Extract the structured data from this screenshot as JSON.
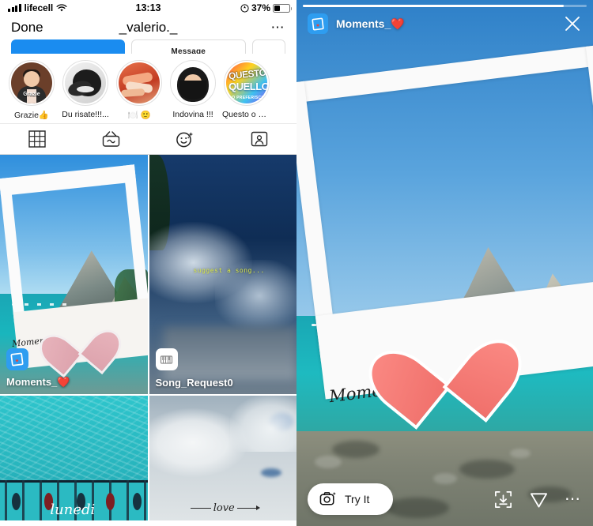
{
  "left_panel": {
    "status_bar": {
      "carrier": "lifecell",
      "time": "13:13",
      "battery_percent": "37%",
      "signal_icon": "signal-bars-icon",
      "wifi_icon": "wifi-icon",
      "location_icon": "location-services-icon",
      "battery_icon": "battery-icon"
    },
    "nav": {
      "done_label": "Done",
      "title": "_valerio._",
      "more_icon": "more-dots-icon"
    },
    "action_buttons": [
      {
        "label": "",
        "style": "primary"
      },
      {
        "label": "Message",
        "style": "ghost"
      },
      {
        "label": "",
        "style": "small"
      }
    ],
    "highlights": [
      {
        "label": "Grazie👍",
        "avatar": "grazie-avatar",
        "inner_text": "Grazie"
      },
      {
        "label": "Du risate!!!...",
        "avatar": "du-risate-avatar"
      },
      {
        "label": "🍽️ 🙂",
        "avatar": "food-avatar"
      },
      {
        "label": "Indovina !!!",
        "avatar": "indovina-avatar"
      },
      {
        "label": "Questo o Q...",
        "avatar": "questo-avatar",
        "art_lines": [
          "QUESTO",
          "QUELLO",
          "O PREFERISCI"
        ]
      }
    ],
    "tabs": [
      {
        "name": "grid-tab",
        "icon": "grid-icon",
        "selected": false
      },
      {
        "name": "igtv-tab",
        "icon": "igtv-icon",
        "selected": false
      },
      {
        "name": "effects-tab",
        "icon": "effects-smiley-icon",
        "selected": true
      },
      {
        "name": "tagged-tab",
        "icon": "tagged-person-icon",
        "selected": false
      }
    ],
    "grid_items": [
      {
        "label": "Moments_❤️",
        "badge_icon": "polaroid-effect-icon",
        "badge_style": "blue",
        "scene": "beach-polaroid",
        "overlay_script": "Moments_"
      },
      {
        "label": "Song_Request0",
        "badge_icon": "piano-keys-icon",
        "badge_style": "white",
        "scene": "dark-clouds",
        "overlay_text": "suggest a song..."
      },
      {
        "label": "",
        "scene": "turquoise-pool",
        "overlay_script": "lunedi"
      },
      {
        "label": "",
        "scene": "white-clouds",
        "overlay_script": "love"
      }
    ]
  },
  "right_panel": {
    "progress_percent": 92,
    "header": {
      "effect_icon": "polaroid-effect-icon",
      "effect_title": "Moments_❤️",
      "close_icon": "close-icon"
    },
    "content": {
      "script_text": "Moments...",
      "sticker": "heart-sticker",
      "scene": "beach-polaroid-large"
    },
    "footer": {
      "try_it_label": "Try It",
      "try_it_icon": "camera-sparkle-icon",
      "save_icon": "save-to-camera-roll-icon",
      "send_icon": "send-paper-plane-icon",
      "more_icon": "more-dots-icon"
    }
  },
  "colors": {
    "accent_blue": "#1a8cf0",
    "effect_badge_blue": "#2e9df0",
    "heart_pink": "#f0706b",
    "sea_teal": "#1ebac0"
  }
}
